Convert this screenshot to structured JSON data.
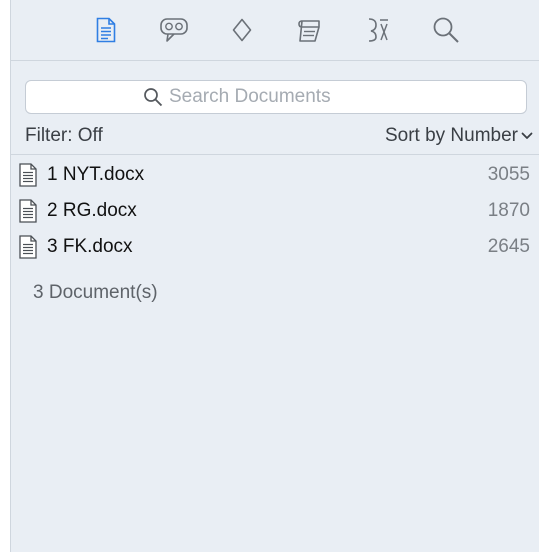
{
  "toolbar": {
    "tools": [
      {
        "icon": "document-icon",
        "active": true
      },
      {
        "icon": "comment-icon",
        "active": false
      },
      {
        "icon": "diamond-icon",
        "active": false
      },
      {
        "icon": "notes-icon",
        "active": false
      },
      {
        "icon": "codes-icon",
        "active": false
      },
      {
        "icon": "magnifier-icon",
        "active": false
      }
    ]
  },
  "search": {
    "placeholder": "Search Documents",
    "value": ""
  },
  "filter": {
    "label": "Filter: Off"
  },
  "sort": {
    "label": "Sort by Number"
  },
  "documents": [
    {
      "name": "1 NYT.docx",
      "count": "3055"
    },
    {
      "name": "2 RG.docx",
      "count": "1870"
    },
    {
      "name": "3 FK.docx",
      "count": "2645"
    }
  ],
  "summary": {
    "total_label": "3 Document(s)"
  },
  "colors": {
    "accent": "#2f7ee3",
    "panel_bg": "#e9eef4",
    "icon_gray": "#6b7178"
  }
}
